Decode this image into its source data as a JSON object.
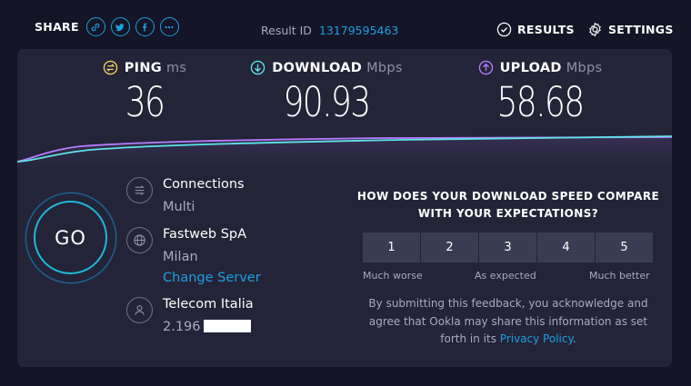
{
  "header": {
    "share_label": "SHARE",
    "share_icons": [
      "link-icon",
      "twitter-icon",
      "facebook-icon",
      "more-icon"
    ],
    "result_id_label": "Result ID",
    "result_id": "13179595463",
    "results_label": "RESULTS",
    "settings_label": "SETTINGS"
  },
  "metrics": {
    "ping": {
      "label": "PING",
      "unit": "ms",
      "value": "36",
      "color": "#f4d35e"
    },
    "download": {
      "label": "DOWNLOAD",
      "unit": "Mbps",
      "value": "90.93",
      "color": "#5fe3e8"
    },
    "upload": {
      "label": "UPLOAD",
      "unit": "Mbps",
      "value": "58.68",
      "color": "#b57cff"
    }
  },
  "go_button": {
    "label": "GO"
  },
  "server": {
    "connections_label": "Connections",
    "connections_value": "Multi",
    "host": "Fastweb SpA",
    "city": "Milan",
    "change_server": "Change Server",
    "isp": "Telecom Italia",
    "ip_prefix": "2.196"
  },
  "feedback": {
    "question": "HOW DOES YOUR DOWNLOAD SPEED COMPARE WITH YOUR EXPECTATIONS?",
    "scale": [
      "1",
      "2",
      "3",
      "4",
      "5"
    ],
    "low_label": "Much worse",
    "mid_label": "As expected",
    "high_label": "Much better",
    "note": "By submitting this feedback, you acknowledge and agree that Ookla may share this information as set forth in its",
    "policy_link": "Privacy Policy",
    "note_end": "."
  },
  "colors": {
    "background": "#141526",
    "panel": "#232437",
    "accent": "#1c9fe0",
    "go_ring": "#1fb7d6"
  }
}
